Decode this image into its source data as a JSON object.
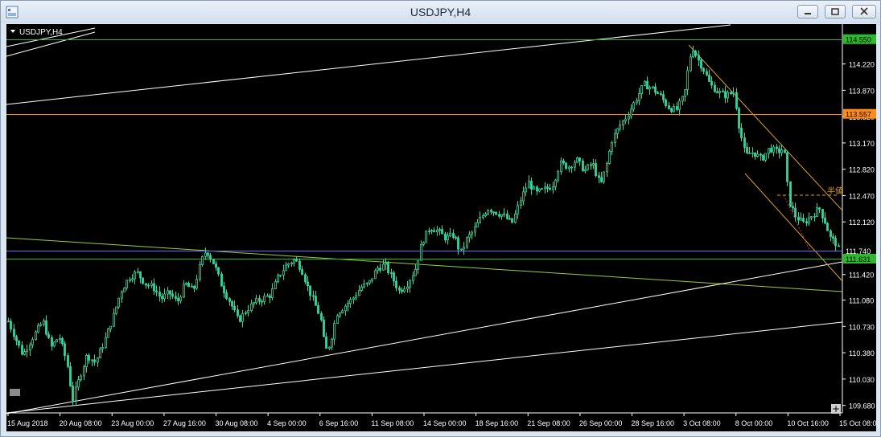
{
  "window": {
    "title": "USDJPY,H4"
  },
  "chart_label": "USDJPY,H4",
  "half_value_label": "半値",
  "colors": {
    "background": "#000000",
    "candles": "#2fd8a0",
    "grid_text": "#ffffff",
    "orange_line": "#ff8c1a",
    "green_line": "#2eb82e",
    "channel": "#e0a020",
    "trend_white": "#ffffff",
    "trend_lime": "#9acd32",
    "blue_line": "#6a6aff"
  },
  "chart_data": {
    "type": "candlestick",
    "title": "USDJPY,H4",
    "ylim": [
      109.58,
      114.75
    ],
    "y_ticks": [
      "114.220",
      "113.870",
      "113.520",
      "113.170",
      "112.820",
      "112.470",
      "112.120",
      "111.420",
      "111.080",
      "110.730",
      "110.380",
      "110.030",
      "109.680"
    ],
    "x_ticks": [
      "15 Aug 2018",
      "20 Aug 08:00",
      "23 Aug 00:00",
      "27 Aug 16:00",
      "30 Aug 08:00",
      "4 Sep 00:00",
      "6 Sep 16:00",
      "11 Sep 08:00",
      "14 Sep 00:00",
      "18 Sep 16:00",
      "21 Sep 08:00",
      "26 Sep 00:00",
      "28 Sep 16:00",
      "3 Oct 08:00",
      "8 Oct 00:00",
      "10 Oct 16:00",
      "15 Oct 08:00"
    ],
    "horizontal_levels": [
      {
        "value": 114.55,
        "label": "114.550",
        "color": "#2eb82e"
      },
      {
        "value": 113.557,
        "label": "113.557",
        "color": "#ff8c1a"
      },
      {
        "value": 111.74,
        "label": "111.740",
        "color": "#6a6aff"
      },
      {
        "value": 111.631,
        "label": "111.631",
        "color": "#2eb82e"
      }
    ],
    "close_path": [
      [
        0,
        110.85
      ],
      [
        10,
        110.6
      ],
      [
        20,
        110.35
      ],
      [
        33,
        110.6
      ],
      [
        45,
        110.8
      ],
      [
        55,
        110.45
      ],
      [
        65,
        110.6
      ],
      [
        75,
        110.25
      ],
      [
        82,
        109.75
      ],
      [
        92,
        110.1
      ],
      [
        100,
        110.35
      ],
      [
        110,
        110.25
      ],
      [
        122,
        110.55
      ],
      [
        132,
        110.85
      ],
      [
        142,
        111.2
      ],
      [
        152,
        111.38
      ],
      [
        162,
        111.45
      ],
      [
        172,
        111.3
      ],
      [
        182,
        111.25
      ],
      [
        192,
        111.1
      ],
      [
        202,
        111.18
      ],
      [
        212,
        111.05
      ],
      [
        222,
        111.3
      ],
      [
        232,
        111.2
      ],
      [
        242,
        111.6
      ],
      [
        248,
        111.75
      ],
      [
        258,
        111.55
      ],
      [
        268,
        111.25
      ],
      [
        278,
        111.05
      ],
      [
        288,
        110.8
      ],
      [
        298,
        110.95
      ],
      [
        308,
        111.05
      ],
      [
        318,
        111.1
      ],
      [
        328,
        111.15
      ],
      [
        338,
        111.4
      ],
      [
        348,
        111.55
      ],
      [
        358,
        111.62
      ],
      [
        366,
        111.5
      ],
      [
        374,
        111.25
      ],
      [
        382,
        111.05
      ],
      [
        390,
        110.85
      ],
      [
        396,
        110.4
      ],
      [
        402,
        110.5
      ],
      [
        410,
        110.9
      ],
      [
        420,
        111.0
      ],
      [
        430,
        111.1
      ],
      [
        440,
        111.25
      ],
      [
        450,
        111.3
      ],
      [
        460,
        111.5
      ],
      [
        470,
        111.55
      ],
      [
        478,
        111.4
      ],
      [
        488,
        111.2
      ],
      [
        498,
        111.3
      ],
      [
        508,
        111.5
      ],
      [
        516,
        111.85
      ],
      [
        526,
        112.05
      ],
      [
        536,
        112.0
      ],
      [
        546,
        111.9
      ],
      [
        556,
        111.95
      ],
      [
        564,
        111.7
      ],
      [
        572,
        111.9
      ],
      [
        580,
        112.0
      ],
      [
        588,
        112.15
      ],
      [
        598,
        112.3
      ],
      [
        608,
        112.25
      ],
      [
        618,
        112.2
      ],
      [
        628,
        112.1
      ],
      [
        638,
        112.4
      ],
      [
        648,
        112.65
      ],
      [
        658,
        112.5
      ],
      [
        668,
        112.55
      ],
      [
        678,
        112.6
      ],
      [
        688,
        112.9
      ],
      [
        698,
        112.85
      ],
      [
        708,
        112.95
      ],
      [
        718,
        112.8
      ],
      [
        728,
        112.9
      ],
      [
        738,
        112.6
      ],
      [
        746,
        112.9
      ],
      [
        752,
        113.2
      ],
      [
        762,
        113.4
      ],
      [
        772,
        113.55
      ],
      [
        782,
        113.75
      ],
      [
        792,
        113.95
      ],
      [
        802,
        113.9
      ],
      [
        812,
        113.8
      ],
      [
        822,
        113.65
      ],
      [
        832,
        113.6
      ],
      [
        842,
        113.8
      ],
      [
        848,
        114.25
      ],
      [
        852,
        114.45
      ],
      [
        858,
        114.3
      ],
      [
        866,
        114.15
      ],
      [
        874,
        113.95
      ],
      [
        884,
        113.85
      ],
      [
        894,
        113.8
      ],
      [
        904,
        113.85
      ],
      [
        910,
        113.4
      ],
      [
        918,
        113.0
      ],
      [
        928,
        113.05
      ],
      [
        938,
        112.95
      ],
      [
        948,
        113.1
      ],
      [
        958,
        113.05
      ],
      [
        966,
        113.1
      ],
      [
        972,
        112.4
      ],
      [
        980,
        112.2
      ],
      [
        990,
        112.1
      ],
      [
        1000,
        112.2
      ],
      [
        1010,
        112.3
      ],
      [
        1018,
        112.1
      ],
      [
        1024,
        111.9
      ],
      [
        1030,
        111.85
      ],
      [
        1036,
        111.7
      ]
    ]
  }
}
